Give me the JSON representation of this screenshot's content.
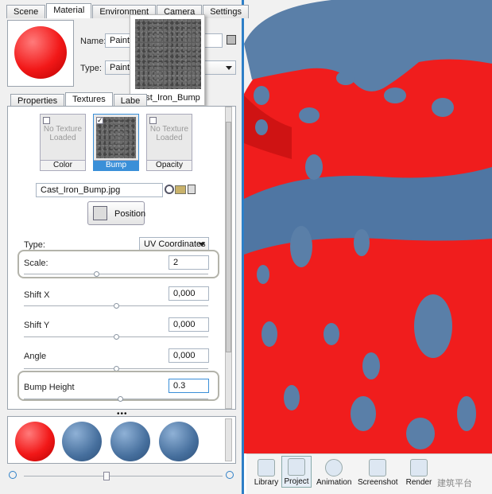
{
  "tabs": [
    "Scene",
    "Material",
    "Environment",
    "Camera",
    "Settings"
  ],
  "material": {
    "name_label": "Name:",
    "name_value": "Paint",
    "type_label": "Type:",
    "type_value": "Paint",
    "preview_caption": "Cast_Iron_Bump"
  },
  "subtabs": [
    "Properties",
    "Textures",
    "Labe"
  ],
  "texture_slots": [
    {
      "caption": "Color",
      "empty_text": "No Texture Loaded",
      "checked": false
    },
    {
      "caption": "Bump",
      "empty_text": "",
      "checked": true
    },
    {
      "caption": "Opacity",
      "empty_text": "No Texture Loaded",
      "checked": false
    }
  ],
  "file_name": "Cast_Iron_Bump.jpg",
  "position_button": "Position",
  "fields": {
    "type_label": "Type:",
    "type_value": "UV Coordinates",
    "scale_label": "Scale:",
    "scale_value": "2",
    "shiftx_label": "Shift X",
    "shiftx_value": "0,000",
    "shifty_label": "Shift Y",
    "shifty_value": "0,000",
    "angle_label": "Angle",
    "angle_value": "0,000",
    "bump_label": "Bump Height",
    "bump_value": "0.3"
  },
  "toolbar": [
    "Library",
    "Project",
    "Animation",
    "Screenshot",
    "Render"
  ],
  "watermark": "建筑平台",
  "colors": {
    "accent": "#2e7fc7",
    "paint_red": "#f22020",
    "spot_blue": "#5b7fa6"
  }
}
